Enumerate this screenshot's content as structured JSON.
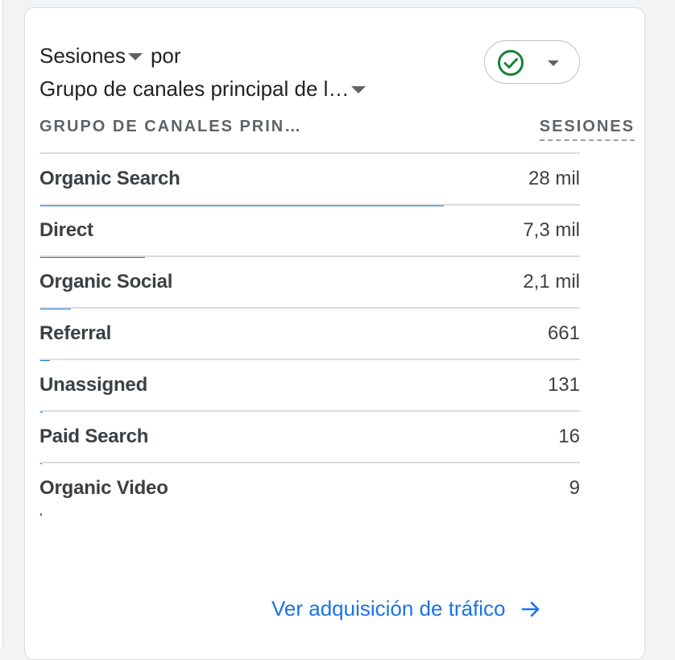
{
  "card": {
    "title_metric": "Sesiones",
    "title_connector": "por",
    "title_dimension": "Grupo de canales principal de l…",
    "status_icon": "check-circle-icon",
    "colors": {
      "accent": "#1a73e8",
      "status_green": "#188038"
    }
  },
  "table": {
    "dimension_header": "GRUPO DE CANALES PRIN…",
    "metric_header": "SESIONES",
    "rows": [
      {
        "label": "Organic Search",
        "value": "28 mil",
        "share": 1.0
      },
      {
        "label": "Direct",
        "value": "7,3 mil",
        "share": 0.26
      },
      {
        "label": "Organic Social",
        "value": "2,1 mil",
        "share": 0.075
      },
      {
        "label": "Referral",
        "value": "661",
        "share": 0.024
      },
      {
        "label": "Unassigned",
        "value": "131",
        "share": 0.005
      },
      {
        "label": "Paid Search",
        "value": "16",
        "share": 0.001
      },
      {
        "label": "Organic Video",
        "value": "9",
        "share": 0.0003
      }
    ]
  },
  "footer": {
    "link_label": "Ver adquisición de tráfico",
    "arrow_icon": "arrow-right-icon"
  }
}
